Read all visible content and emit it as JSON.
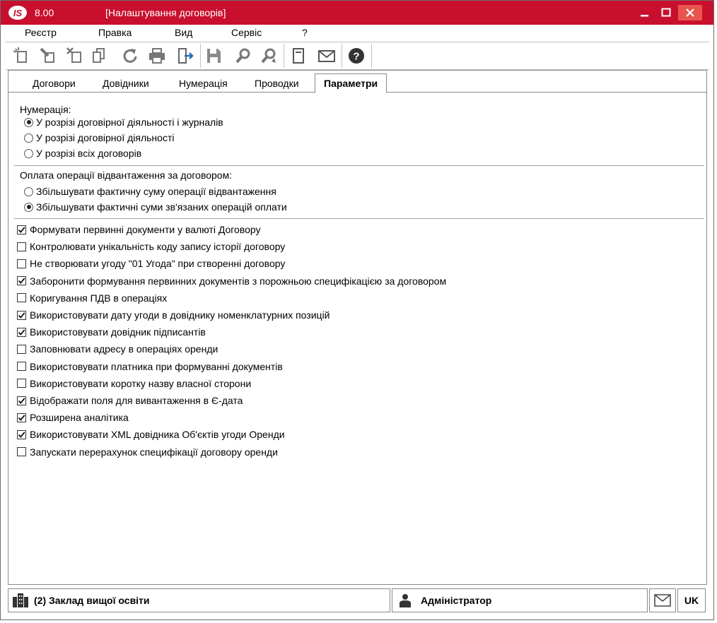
{
  "window": {
    "version": "8.00",
    "title": "[Налаштування договорів]",
    "logo_text": "IS",
    "accent": "#c8102e"
  },
  "menu": [
    "Реєстр",
    "Правка",
    "Вид",
    "Сервіс",
    "?"
  ],
  "toolbar": {
    "icons": [
      "new-doc-icon",
      "edit-doc-icon",
      "delete-doc-icon",
      "copy-doc-icon",
      "refresh-icon",
      "print-icon",
      "exit-icon",
      "save-icon",
      "find-icon",
      "find-next-icon",
      "notebook-icon",
      "mail-icon",
      "help-icon"
    ]
  },
  "tabs": [
    {
      "label": "Договори",
      "active": false
    },
    {
      "label": "Довідники",
      "active": false
    },
    {
      "label": "Нумерація",
      "active": false
    },
    {
      "label": "Проводки",
      "active": false
    },
    {
      "label": "Параметри",
      "active": true
    }
  ],
  "numbering": {
    "label": "Нумерація:",
    "options": [
      {
        "label": "У розрізі договірної діяльності і журналів",
        "selected": true
      },
      {
        "label": "У розрізі договірної діяльності",
        "selected": false
      },
      {
        "label": "У розрізі всіх договорів",
        "selected": false
      }
    ]
  },
  "payment": {
    "label": "Оплата операції відвантаження за договором:",
    "options": [
      {
        "label": "Збільшувати фактичну суму операції відвантаження",
        "selected": false
      },
      {
        "label": "Збільшувати фактичні суми зв'язаних операцій оплати",
        "selected": true
      }
    ]
  },
  "checkboxes": [
    {
      "label": "Формувати первинні документи у валюті Договору",
      "checked": true
    },
    {
      "label": "Контролювати унікальність коду запису історії договору",
      "checked": false
    },
    {
      "label": "Не створювати угоду \"01 Угода\" при створенні договору",
      "checked": false
    },
    {
      "label": "Заборонити формування первинних документів з порожньою специфікацією за договором",
      "checked": true
    },
    {
      "label": "Коригування ПДВ в операціях",
      "checked": false
    },
    {
      "label": "Використовувати дату угоди в довіднику номенклатурних позицій",
      "checked": true
    },
    {
      "label": "Використовувати довідник підписантів",
      "checked": true
    },
    {
      "label": "Заповнювати адресу в операціях оренди",
      "checked": false
    },
    {
      "label": "Використовувати платника при формуванні документів",
      "checked": false
    },
    {
      "label": "Використовувати коротку назву власної сторони",
      "checked": false
    },
    {
      "label": "Відображати поля для вивантаження в Є-дата",
      "checked": true
    },
    {
      "label": "Розширена аналітика",
      "checked": true
    },
    {
      "label": "Використовувати XML довідника Об'єктів угоди Оренди",
      "checked": true
    },
    {
      "label": "Запускати перерахунок специфікації договору оренди",
      "checked": false
    }
  ],
  "status": {
    "organization": "(2) Заклад вищої освіти",
    "user": "Адміністратор",
    "language": "UK"
  }
}
